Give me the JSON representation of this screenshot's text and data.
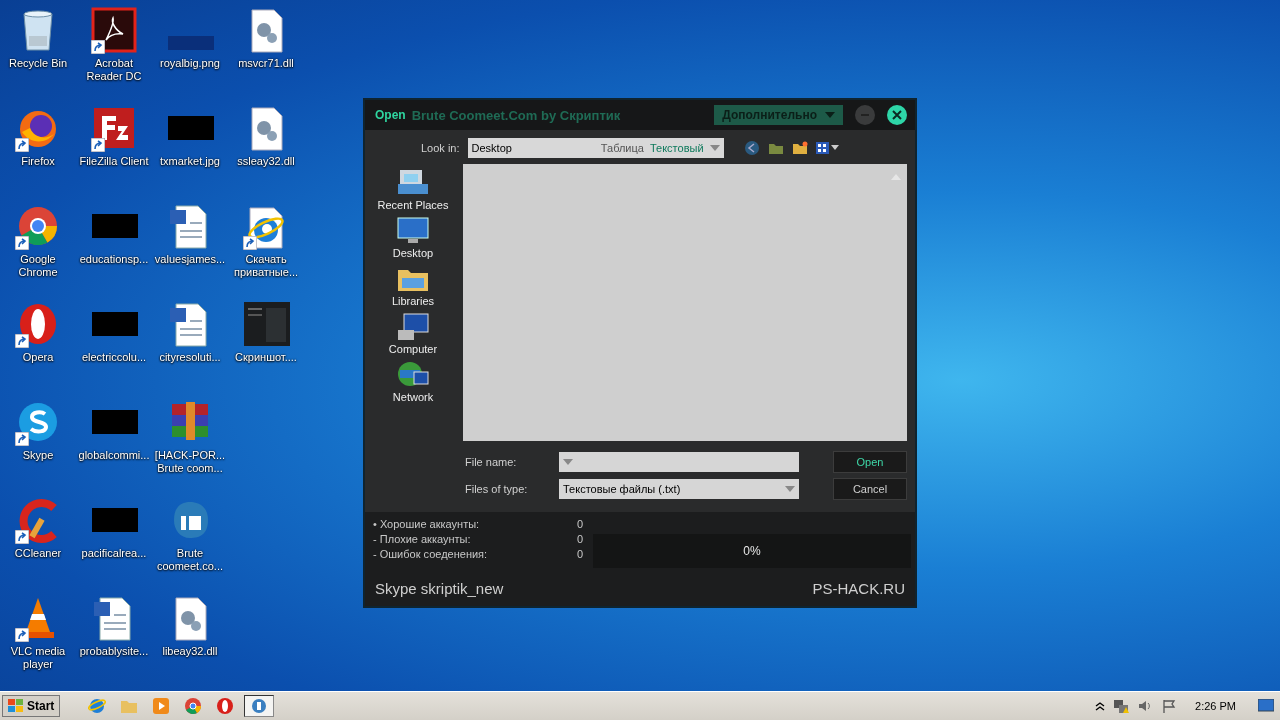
{
  "desktop": {
    "icons": [
      {
        "label": "Recycle Bin",
        "kind": "recycle",
        "shortcut": false
      },
      {
        "label": "Firefox",
        "kind": "firefox",
        "shortcut": true
      },
      {
        "label": "Google Chrome",
        "kind": "chrome",
        "shortcut": true
      },
      {
        "label": "Opera",
        "kind": "opera",
        "shortcut": true
      },
      {
        "label": "Skype",
        "kind": "skype",
        "shortcut": true
      },
      {
        "label": "CCleaner",
        "kind": "ccleaner",
        "shortcut": true
      },
      {
        "label": "VLC media player",
        "kind": "vlc",
        "shortcut": true
      },
      {
        "label": "Acrobat Reader DC",
        "kind": "pdf",
        "shortcut": true
      },
      {
        "label": "FileZilla Client",
        "kind": "filezilla",
        "shortcut": true
      },
      {
        "label": "educationsp...",
        "kind": "thumb",
        "shortcut": false
      },
      {
        "label": "electriccolu...",
        "kind": "thumb",
        "shortcut": false
      },
      {
        "label": "globalcommi...",
        "kind": "thumb",
        "shortcut": false
      },
      {
        "label": "pacificalrea...",
        "kind": "thumb",
        "shortcut": false
      },
      {
        "label": "probablysite...",
        "kind": "word",
        "shortcut": false
      },
      {
        "label": "royalbig.png",
        "kind": "thumb_navy",
        "shortcut": false
      },
      {
        "label": "txmarket.jpg",
        "kind": "thumb",
        "shortcut": false
      },
      {
        "label": "valuesjames...",
        "kind": "word",
        "shortcut": false
      },
      {
        "label": "cityresoluti...",
        "kind": "word",
        "shortcut": false
      },
      {
        "label": "[HACK-POR... Brute coom...",
        "kind": "archive",
        "shortcut": false
      },
      {
        "label": "Brute coomeet.co...",
        "kind": "splash",
        "shortcut": false
      },
      {
        "label": "libeay32.dll",
        "kind": "dll",
        "shortcut": false
      },
      {
        "label": "msvcr71.dll",
        "kind": "dll",
        "shortcut": false
      },
      {
        "label": "ssleay32.dll",
        "kind": "dll",
        "shortcut": false
      },
      {
        "label": "Скачать приватные...",
        "kind": "ie",
        "shortcut": true
      },
      {
        "label": "Скриншот....",
        "kind": "screenshot",
        "shortcut": false
      }
    ]
  },
  "window": {
    "title": "Brute Coomeet.Com by Скриптик",
    "menu_button": "Дополнительно",
    "stats": [
      {
        "label": "• Хорошие аккаунты:",
        "value": "0"
      },
      {
        "label": "- Плохие аккаунты:",
        "value": "0"
      },
      {
        "label": "- Ошибок соеденения:",
        "value": "0"
      }
    ],
    "progress": {
      "label": "0%",
      "level": 0
    },
    "footer_left": "Skype skriptik_new",
    "footer_right": "PS-HACK.RU"
  },
  "open_dialog": {
    "title": "Open",
    "look_in_label": "Look in:",
    "look_in_value": "Desktop",
    "format_tabs": [
      {
        "label": "Таблица",
        "selected": false
      },
      {
        "label": "Текстовый",
        "selected": true
      }
    ],
    "places": [
      {
        "label": "Recent Places",
        "kind": "recent"
      },
      {
        "label": "Desktop",
        "kind": "desktop"
      },
      {
        "label": "Libraries",
        "kind": "libraries"
      },
      {
        "label": "Computer",
        "kind": "computer"
      },
      {
        "label": "Network",
        "kind": "network"
      }
    ],
    "file_name_label": "File name:",
    "files_of_type_label": "Files of type:",
    "files_of_type_value": "Текстовые файлы (.txt)",
    "buttons": [
      {
        "label": "Open",
        "kind": "primary"
      },
      {
        "label": "Cancel",
        "kind": "secondary"
      }
    ]
  },
  "taskbar": {
    "start": "Start",
    "apps": [
      {
        "kind": "ie",
        "active": false
      },
      {
        "kind": "folder",
        "active": false
      },
      {
        "kind": "media",
        "active": false
      },
      {
        "kind": "chrome",
        "active": false
      },
      {
        "kind": "opera",
        "active": false
      },
      {
        "kind": "app",
        "active": true
      }
    ],
    "clock": "2:26 PM"
  }
}
